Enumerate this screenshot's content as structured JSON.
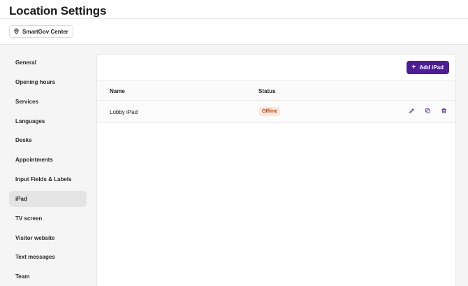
{
  "header": {
    "title": "Location Settings"
  },
  "location": {
    "name": "SmartGov Center",
    "icon": "map-pin-icon"
  },
  "sidebar": {
    "items": [
      {
        "label": "General",
        "active": false
      },
      {
        "label": "Opening hours",
        "active": false
      },
      {
        "label": "Services",
        "active": false
      },
      {
        "label": "Languages",
        "active": false
      },
      {
        "label": "Desks",
        "active": false
      },
      {
        "label": "Appointments",
        "active": false
      },
      {
        "label": "Input Fields & Labels",
        "active": false
      },
      {
        "label": "iPad",
        "active": true
      },
      {
        "label": "TV screen",
        "active": false
      },
      {
        "label": "Visitor website",
        "active": false
      },
      {
        "label": "Text messages",
        "active": false
      },
      {
        "label": "Team",
        "active": false
      }
    ]
  },
  "main": {
    "add_button": {
      "label": "Add iPad",
      "icon": "plus-icon"
    },
    "table": {
      "columns": [
        "Name",
        "Status"
      ],
      "rows": [
        {
          "name": "Lobby iPad",
          "status": "Offline",
          "actions": [
            "edit-icon",
            "duplicate-icon",
            "trash-icon"
          ]
        }
      ]
    }
  },
  "colors": {
    "accent": "#4c1d95",
    "badge_bg": "#fde7da",
    "badge_text": "#c2410c",
    "icon": "#4c1d95"
  }
}
